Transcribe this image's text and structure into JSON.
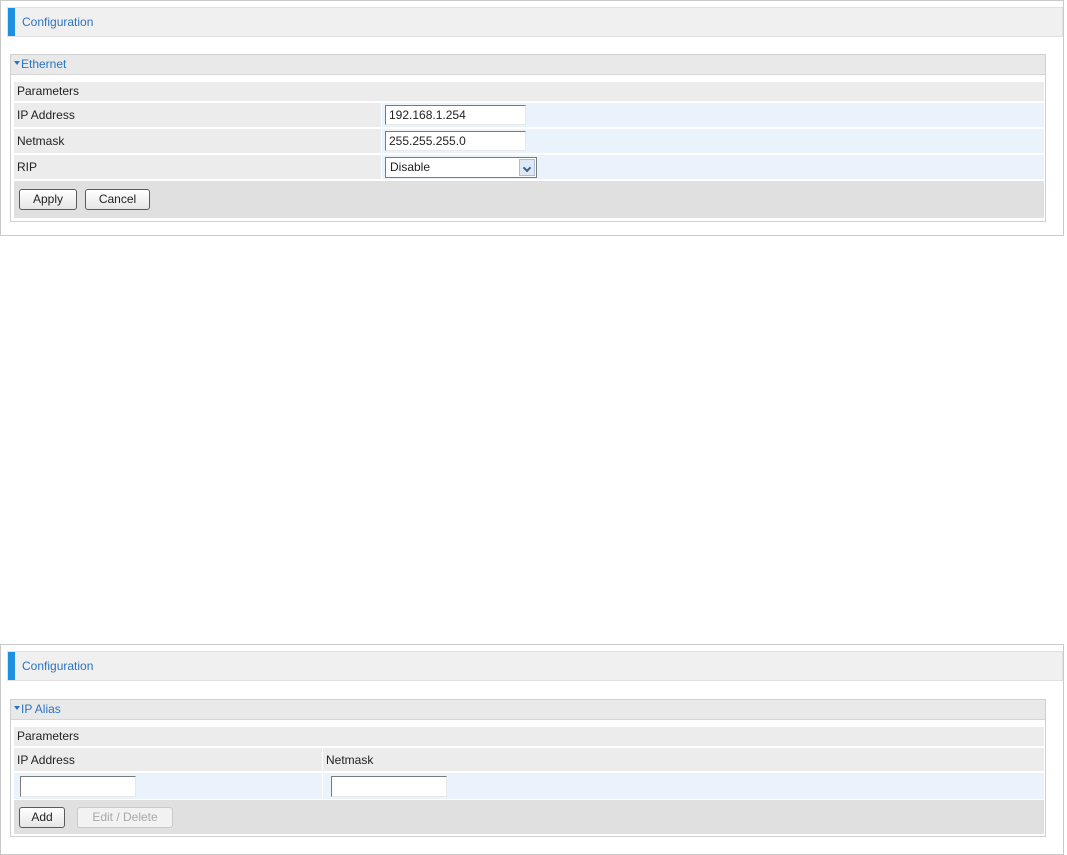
{
  "ethernet_panel": {
    "title": "Configuration",
    "section": "Ethernet",
    "parameters_label": "Parameters",
    "fields": [
      {
        "label": "IP Address",
        "value": "192.168.1.254"
      },
      {
        "label": "Netmask",
        "value": "255.255.255.0"
      },
      {
        "label": "RIP",
        "value": "Disable"
      }
    ],
    "apply_label": "Apply",
    "cancel_label": "Cancel"
  },
  "ip_alias_panel": {
    "title": "Configuration",
    "section": "IP Alias",
    "parameters_label": "Parameters",
    "col_ip": "IP Address",
    "col_netmask": "Netmask",
    "ip_value": "",
    "netmask_value": "",
    "add_label": "Add",
    "edit_delete_label": "Edit / Delete"
  },
  "colors": {
    "accent": "#1f8fe0",
    "title_text": "#2a74c0",
    "row_gray": "#ececec",
    "row_blue": "#eaf3fb"
  }
}
